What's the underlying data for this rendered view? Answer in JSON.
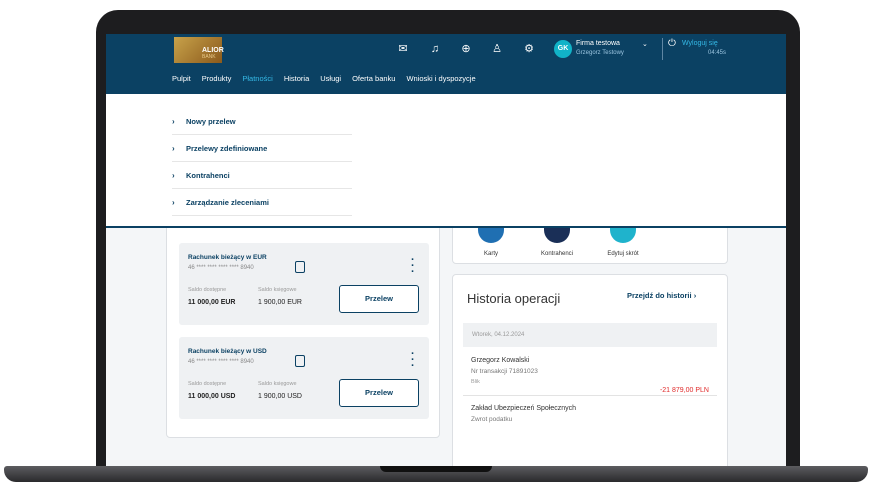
{
  "header": {
    "brand": "ALIOR",
    "brand_sub": "BANK",
    "icons": [
      "mail-icon",
      "bell-icon",
      "download-icon",
      "user-icon",
      "settings-icon"
    ],
    "avatar_initials": "GK",
    "company": "Firma testowa",
    "user": "Grzegorz Testowy",
    "logout": "Wyloguj się",
    "timer": "04:45s"
  },
  "nav": {
    "items": [
      "Pulpit",
      "Produkty",
      "Płatności",
      "Historia",
      "Usługi",
      "Oferta banku",
      "Wnioski i dyspozycje"
    ],
    "active": "Płatności"
  },
  "dropdown": {
    "items": [
      "Nowy przelew",
      "Przelewy zdefiniowane",
      "Kontrahenci",
      "Zarządzanie zleceniami"
    ]
  },
  "accounts": [
    {
      "title": "Rachunek bieżący w EUR",
      "number": "46 **** **** **** **** 8940",
      "available_label": "Saldo dostępne",
      "available": "11 000,00 EUR",
      "booked_label": "Saldo księgowe",
      "booked": "1 900,00 EUR",
      "button": "Przelew"
    },
    {
      "title": "Rachunek bieżący w USD",
      "number": "46 **** **** **** **** 8940",
      "available_label": "Saldo dostępne",
      "available": "11 000,00 USD",
      "booked_label": "Saldo księgowe",
      "booked": "1 900,00 USD",
      "button": "Przelew"
    }
  ],
  "shortcuts": [
    {
      "label": "Karty",
      "color": "#1f6fb2"
    },
    {
      "label": "Kontrahenci",
      "color": "#1a2f57"
    },
    {
      "label": "Edytuj skrót",
      "color": "#1fb3cc"
    }
  ],
  "history": {
    "title": "Historia operacji",
    "link": "Przejdź do historii",
    "date": "Wtorek, 04.12.2024",
    "transactions": [
      {
        "name": "Grzegorz Kowalski",
        "sub": "Nr transakcji 71891023",
        "method": "Blik",
        "amount": "-21 879,00 PLN"
      },
      {
        "name": "Zakład Ubezpieczeń Społecznych",
        "sub": "Zwrot podatku"
      }
    ]
  }
}
